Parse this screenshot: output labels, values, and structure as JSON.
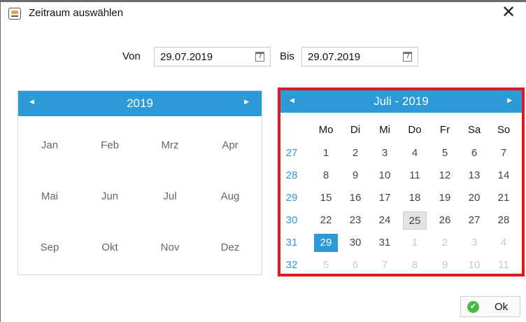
{
  "window": {
    "title": "Zeitraum auswählen",
    "close_glyph": "✕"
  },
  "range": {
    "from_label": "Von",
    "from_value": "29.07.2019",
    "to_label": "Bis",
    "to_value": "29.07.2019"
  },
  "year_view": {
    "title": "2019",
    "months": [
      "Jan",
      "Feb",
      "Mrz",
      "Apr",
      "Mai",
      "Jun",
      "Jul",
      "Aug",
      "Sep",
      "Okt",
      "Nov",
      "Dez"
    ]
  },
  "month_view": {
    "title": "Juli - 2019",
    "weekdays": [
      "Mo",
      "Di",
      "Mi",
      "Do",
      "Fr",
      "Sa",
      "So"
    ],
    "weeks": [
      {
        "number": "27",
        "days": [
          {
            "d": "1"
          },
          {
            "d": "2"
          },
          {
            "d": "3"
          },
          {
            "d": "4"
          },
          {
            "d": "5"
          },
          {
            "d": "6"
          },
          {
            "d": "7"
          }
        ]
      },
      {
        "number": "28",
        "days": [
          {
            "d": "8"
          },
          {
            "d": "9"
          },
          {
            "d": "10"
          },
          {
            "d": "11"
          },
          {
            "d": "12"
          },
          {
            "d": "13"
          },
          {
            "d": "14"
          }
        ]
      },
      {
        "number": "29",
        "days": [
          {
            "d": "15"
          },
          {
            "d": "16"
          },
          {
            "d": "17"
          },
          {
            "d": "18"
          },
          {
            "d": "19"
          },
          {
            "d": "20"
          },
          {
            "d": "21"
          }
        ]
      },
      {
        "number": "30",
        "days": [
          {
            "d": "22"
          },
          {
            "d": "23"
          },
          {
            "d": "24"
          },
          {
            "d": "25",
            "today": true
          },
          {
            "d": "26"
          },
          {
            "d": "27"
          },
          {
            "d": "28"
          }
        ]
      },
      {
        "number": "31",
        "days": [
          {
            "d": "29",
            "selected": true
          },
          {
            "d": "30"
          },
          {
            "d": "31"
          },
          {
            "d": "1",
            "other": true
          },
          {
            "d": "2",
            "other": true
          },
          {
            "d": "3",
            "other": true
          },
          {
            "d": "4",
            "other": true
          }
        ]
      },
      {
        "number": "32",
        "days": [
          {
            "d": "5",
            "other": true
          },
          {
            "d": "6",
            "other": true
          },
          {
            "d": "7",
            "other": true
          },
          {
            "d": "8",
            "other": true
          },
          {
            "d": "9",
            "other": true
          },
          {
            "d": "10",
            "other": true
          },
          {
            "d": "11",
            "other": true
          }
        ]
      }
    ]
  },
  "footer": {
    "ok_label": "Ok"
  },
  "colors": {
    "accent": "#2b9ad6",
    "highlight_frame": "#e3171f",
    "ok_icon": "#49b84a"
  }
}
